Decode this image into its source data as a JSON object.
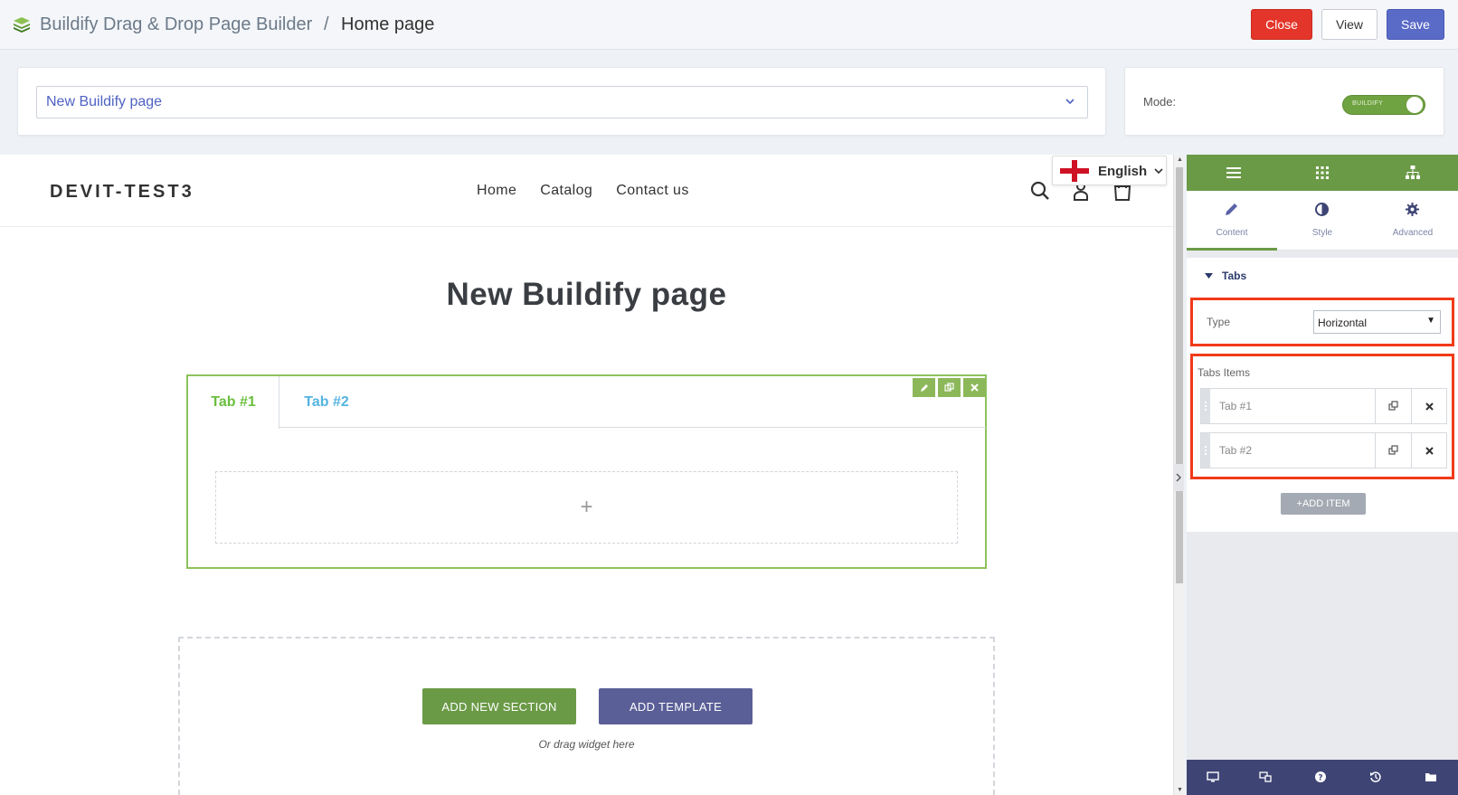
{
  "header": {
    "app_title": "Buildify Drag & Drop Page Builder",
    "separator": "/",
    "page_name": "Home page",
    "close_label": "Close",
    "view_label": "View",
    "save_label": "Save"
  },
  "page_selector": {
    "value": "New Buildify page"
  },
  "mode": {
    "label": "Mode:",
    "toggle_text": "BUILDIFY",
    "enabled": true
  },
  "site": {
    "brand": "DEVIT-TEST3",
    "nav": [
      "Home",
      "Catalog",
      "Contact us"
    ],
    "language": "English",
    "heading": "New Buildify page"
  },
  "tabs_widget": {
    "tabs": [
      "Tab #1",
      "Tab #2"
    ],
    "active_tab": 0,
    "add_glyph": "+"
  },
  "empty_section": {
    "add_section_label": "ADD NEW SECTION",
    "add_template_label": "ADD TEMPLATE",
    "drag_hint": "Or drag widget here"
  },
  "panel": {
    "tabs": [
      "Content",
      "Style",
      "Advanced"
    ],
    "active_tab": "Content",
    "section_title": "Tabs",
    "type_label": "Type",
    "type_value": "Horizontal",
    "items_label": "Tabs Items",
    "items": [
      "Tab #1",
      "Tab #2"
    ],
    "add_item_label": "ADD ITEM"
  },
  "colors": {
    "accent_green": "#6b9a47",
    "tab_active": "#6abf3e",
    "tab_inactive": "#54b4e0",
    "close_red": "#e4352a",
    "save_blue": "#5a6ac7",
    "template_purple": "#5b5f97",
    "highlight_red": "#f03a17",
    "footer_navy": "#3e4575"
  }
}
